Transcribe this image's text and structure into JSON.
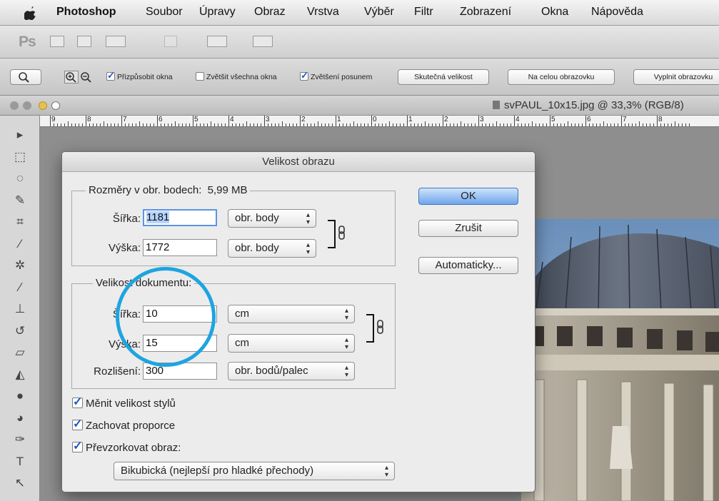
{
  "menubar": {
    "app": "Photoshop",
    "items": [
      "Soubor",
      "Úpravy",
      "Obraz",
      "Vrstva",
      "Výběr",
      "Filtr",
      "Zobrazení",
      "Okna",
      "Nápověda"
    ]
  },
  "appbar": {
    "logo": "Ps"
  },
  "options": {
    "zoom_buttons": [
      "zoom-in-icon",
      "zoom-out-icon"
    ],
    "checkboxes": [
      {
        "label": "Přizpůsobit okna",
        "checked": true
      },
      {
        "label": "Zvětšit všechna okna",
        "checked": false
      },
      {
        "label": "Zvětšení posunem",
        "checked": true
      }
    ],
    "buttons": [
      "Skutečná velikost",
      "Na celou obrazovku",
      "Vyplnit obrazovku"
    ]
  },
  "document": {
    "title": "svPAUL_10x15.jpg @ 33,3% (RGB/8)",
    "ruler_labels": [
      "9",
      "8",
      "7",
      "6",
      "5",
      "4",
      "3",
      "2",
      "1",
      "0",
      "1",
      "2",
      "3",
      "4",
      "5",
      "6",
      "7",
      "8"
    ]
  },
  "tools": [
    "move-icon",
    "marquee-icon",
    "lasso-icon",
    "quick-select-icon",
    "crop-icon",
    "eyedropper-icon",
    "healing-icon",
    "brush-icon",
    "stamp-icon",
    "history-brush-icon",
    "eraser-icon",
    "bucket-icon",
    "blur-icon",
    "dodge-icon",
    "pen-icon",
    "type-icon",
    "path-select-icon"
  ],
  "dialog": {
    "title": "Velikost obrazu",
    "pixel_dims": {
      "legend": "Rozměry v obr. bodech:",
      "size": "5,99 MB",
      "width_label": "Šířka:",
      "width_value": "1181",
      "width_unit": "obr. body",
      "height_label": "Výška:",
      "height_value": "1772",
      "height_unit": "obr. body"
    },
    "doc_size": {
      "legend": "Velikost dokumentu:",
      "width_label": "Šířka:",
      "width_value": "10",
      "width_unit": "cm",
      "height_label": "Výška:",
      "height_value": "15",
      "height_unit": "cm",
      "res_label": "Rozlišení:",
      "res_value": "300",
      "res_unit": "obr. bodů/palec"
    },
    "checkboxes": [
      {
        "label": "Měnit velikost stylů",
        "checked": true
      },
      {
        "label": "Zachovat proporce",
        "checked": true
      },
      {
        "label": "Převzorkovat obraz:",
        "checked": true
      }
    ],
    "resample_method": "Bikubická (nejlepší pro hladké přechody)",
    "buttons": {
      "ok": "OK",
      "cancel": "Zrušit",
      "auto": "Automaticky..."
    }
  },
  "colors": {
    "highlight_circle": "#1ea4e0",
    "ok_button": "#6ea5ec",
    "checkbox": "#1a57c8"
  }
}
